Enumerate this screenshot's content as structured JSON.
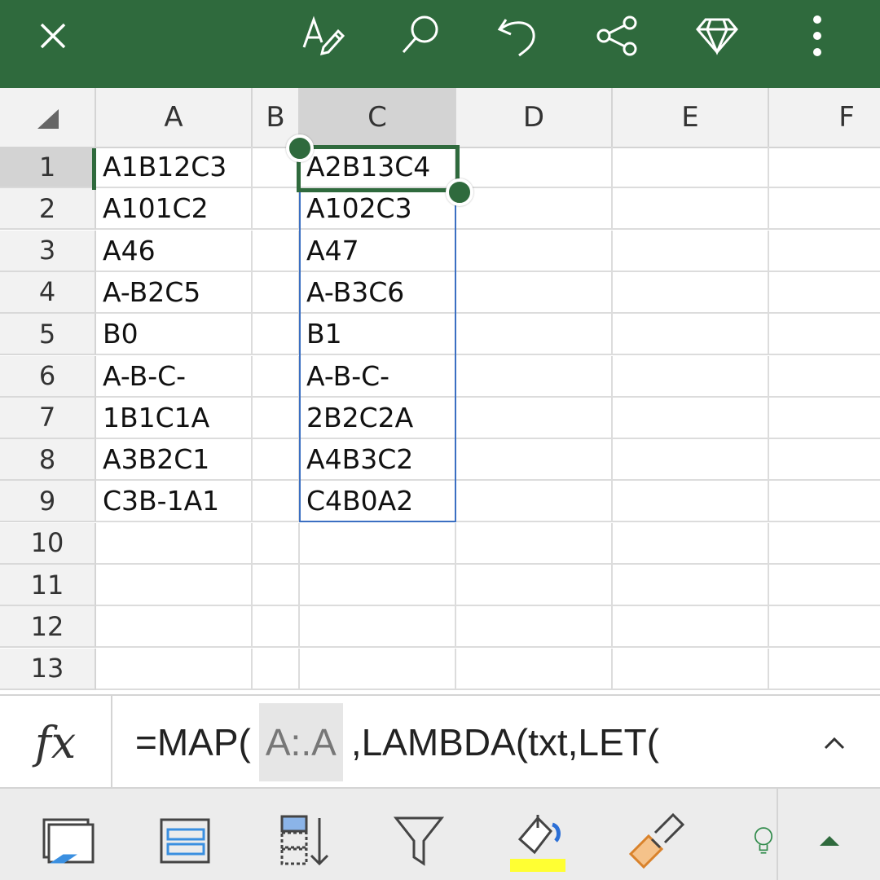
{
  "toolbar": {
    "icons": [
      "close-icon",
      "pen-icon",
      "search-icon",
      "undo-icon",
      "share-icon",
      "diamond-icon",
      "more-icon"
    ]
  },
  "columns": [
    "A",
    "B",
    "C",
    "D",
    "E",
    "F"
  ],
  "rows": [
    "1",
    "2",
    "3",
    "4",
    "5",
    "6",
    "7",
    "8",
    "9",
    "10",
    "11",
    "12",
    "13"
  ],
  "cells": {
    "A": [
      "A1B12C3",
      "A101C2",
      "A46",
      "A-B2C5",
      "B0",
      "A-B-C-",
      "1B1C1A",
      "A3B2C1",
      "C3B-1A1"
    ],
    "C": [
      "A2B13C4",
      "A102C3",
      "A47",
      "A-B3C6",
      "B1",
      "A-B-C-",
      "2B2C2A",
      "A4B3C2",
      "C4B0A2"
    ]
  },
  "formula_bar": {
    "fx_label": "fx",
    "prefix": "=MAP(",
    "reference": "A:.A",
    "suffix": ",LAMBDA(txt,LET("
  },
  "colors": {
    "toolbar": "#2f6a3d",
    "selection_border": "#3b6fc2",
    "active_border": "#2f6a3d"
  },
  "ribbon": {
    "icons": [
      "view-icon",
      "wrap-icon",
      "sort-icon",
      "filter-icon",
      "fill-color-icon",
      "format-painter-icon",
      "ideas-icon",
      "collapse-icon"
    ]
  }
}
